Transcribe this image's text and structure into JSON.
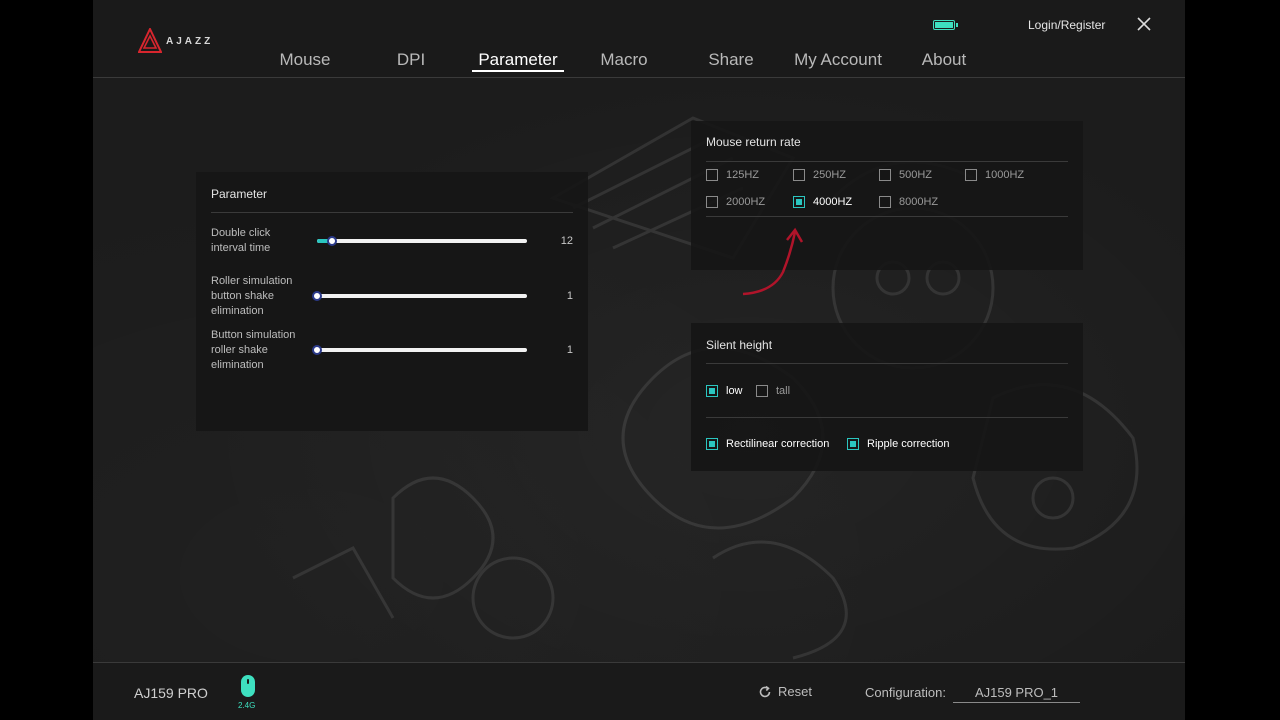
{
  "brand": {
    "logo_text": "AJAZZ",
    "accent": "#2bc6c0",
    "logo_color": "#d8262e"
  },
  "header": {
    "login_label": "Login/Register",
    "battery_icon": "battery-icon",
    "close_icon": "close-icon"
  },
  "nav": {
    "tabs": [
      {
        "label": "Mouse"
      },
      {
        "label": "DPI"
      },
      {
        "label": "Parameter",
        "active": true
      },
      {
        "label": "Macro"
      },
      {
        "label": "Share"
      },
      {
        "label": "My Account"
      },
      {
        "label": "About"
      }
    ]
  },
  "parameter": {
    "title": "Parameter",
    "sliders": [
      {
        "label_lines": [
          "Double click",
          "interval time"
        ],
        "value": "12",
        "level": 0.07
      },
      {
        "label_lines": [
          "Roller simulation",
          "button shake",
          "elimination"
        ],
        "value": "1",
        "level": 0.0
      },
      {
        "label_lines": [
          "Button simulation",
          "roller shake",
          "elimination"
        ],
        "value": "1",
        "level": 0.0
      }
    ]
  },
  "return_rate": {
    "title": "Mouse return rate",
    "options": [
      {
        "label": "125HZ",
        "checked": false
      },
      {
        "label": "250HZ",
        "checked": false
      },
      {
        "label": "500HZ",
        "checked": false
      },
      {
        "label": "1000HZ",
        "checked": false
      },
      {
        "label": "2000HZ",
        "checked": false
      },
      {
        "label": "4000HZ",
        "checked": true
      },
      {
        "label": "8000HZ",
        "checked": false
      }
    ]
  },
  "silent_height": {
    "title": "Silent height",
    "options": [
      {
        "label": "low",
        "checked": true
      },
      {
        "label": "tall",
        "checked": false
      }
    ],
    "corrections": [
      {
        "label": "Rectilinear correction",
        "checked": true
      },
      {
        "label": "Ripple correction",
        "checked": true
      }
    ]
  },
  "footer": {
    "device_name": "AJ159 PRO",
    "connection": "2.4G",
    "reset_label": "Reset",
    "config_label": "Configuration:",
    "config_value": "AJ159 PRO_1"
  }
}
